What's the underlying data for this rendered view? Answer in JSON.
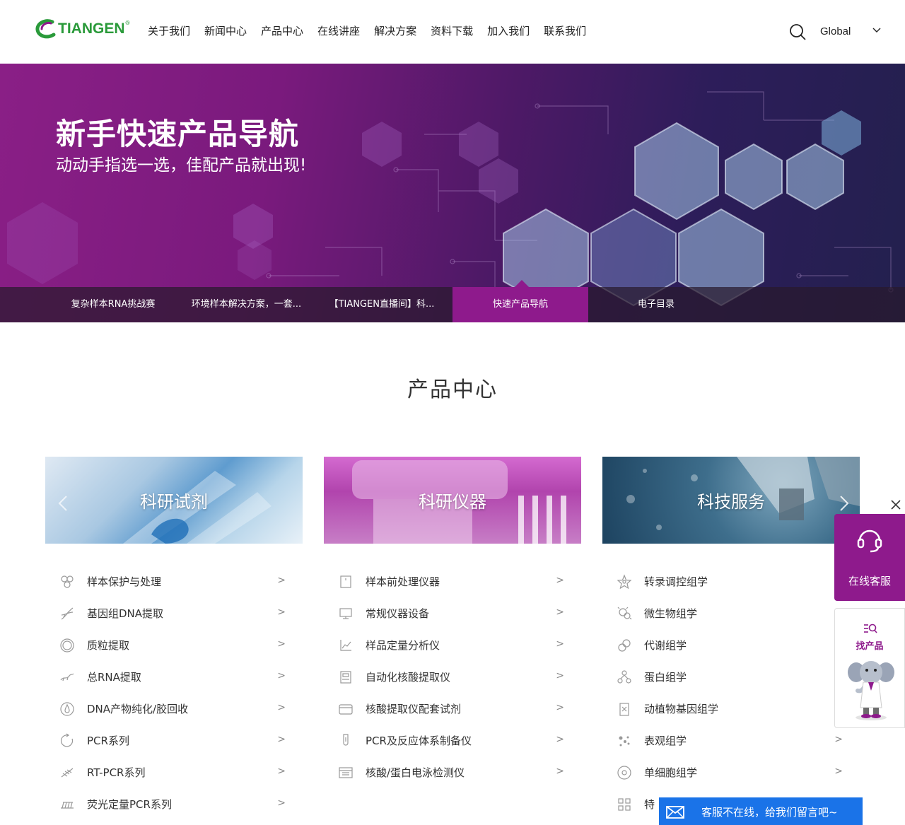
{
  "header": {
    "logo_text": "TIANGEN",
    "logo_reg": "®",
    "nav": [
      "关于我们",
      "新闻中心",
      "产品中心",
      "在线讲座",
      "解决方案",
      "资料下载",
      "加入我们",
      "联系我们"
    ],
    "region": "Global"
  },
  "banner": {
    "title": "新手快速产品导航",
    "subtitle": "动动手指选一选，佳配产品就出现!",
    "tabs": [
      "复杂样本RNA挑战赛",
      "环境样本解决方案，一套...",
      "【TIANGEN直播间】科...",
      "快速产品导航",
      "电子目录"
    ],
    "active_tab": 3
  },
  "products": {
    "title": "产品中心",
    "cards": [
      "科研试剂",
      "科研仪器",
      "科技服务"
    ],
    "col1": [
      "样本保护与处理",
      "基因组DNA提取",
      "质粒提取",
      "总RNA提取",
      "DNA产物纯化/胶回收",
      "PCR系列",
      "RT-PCR系列",
      "荧光定量PCR系列"
    ],
    "col2": [
      "样本前处理仪器",
      "常规仪器设备",
      "样品定量分析仪",
      "自动化核酸提取仪",
      "核酸提取仪配套试剂",
      "PCR及反应体系制备仪",
      "核酸/蛋白电泳检测仪"
    ],
    "col3": [
      "转录调控组学",
      "微生物组学",
      "代谢组学",
      "蛋白组学",
      "动植物基因组学",
      "表观组学",
      "单细胞组学",
      "特"
    ],
    "chevron": ">"
  },
  "widgets": {
    "customer_service": "在线客服",
    "find_product": "找产品",
    "message_bar": "客服不在线，给我们留言吧~"
  },
  "colors": {
    "brand_green": "#2a9a3a",
    "brand_purple": "#8e1a8c",
    "message_blue": "#1a73e8"
  }
}
